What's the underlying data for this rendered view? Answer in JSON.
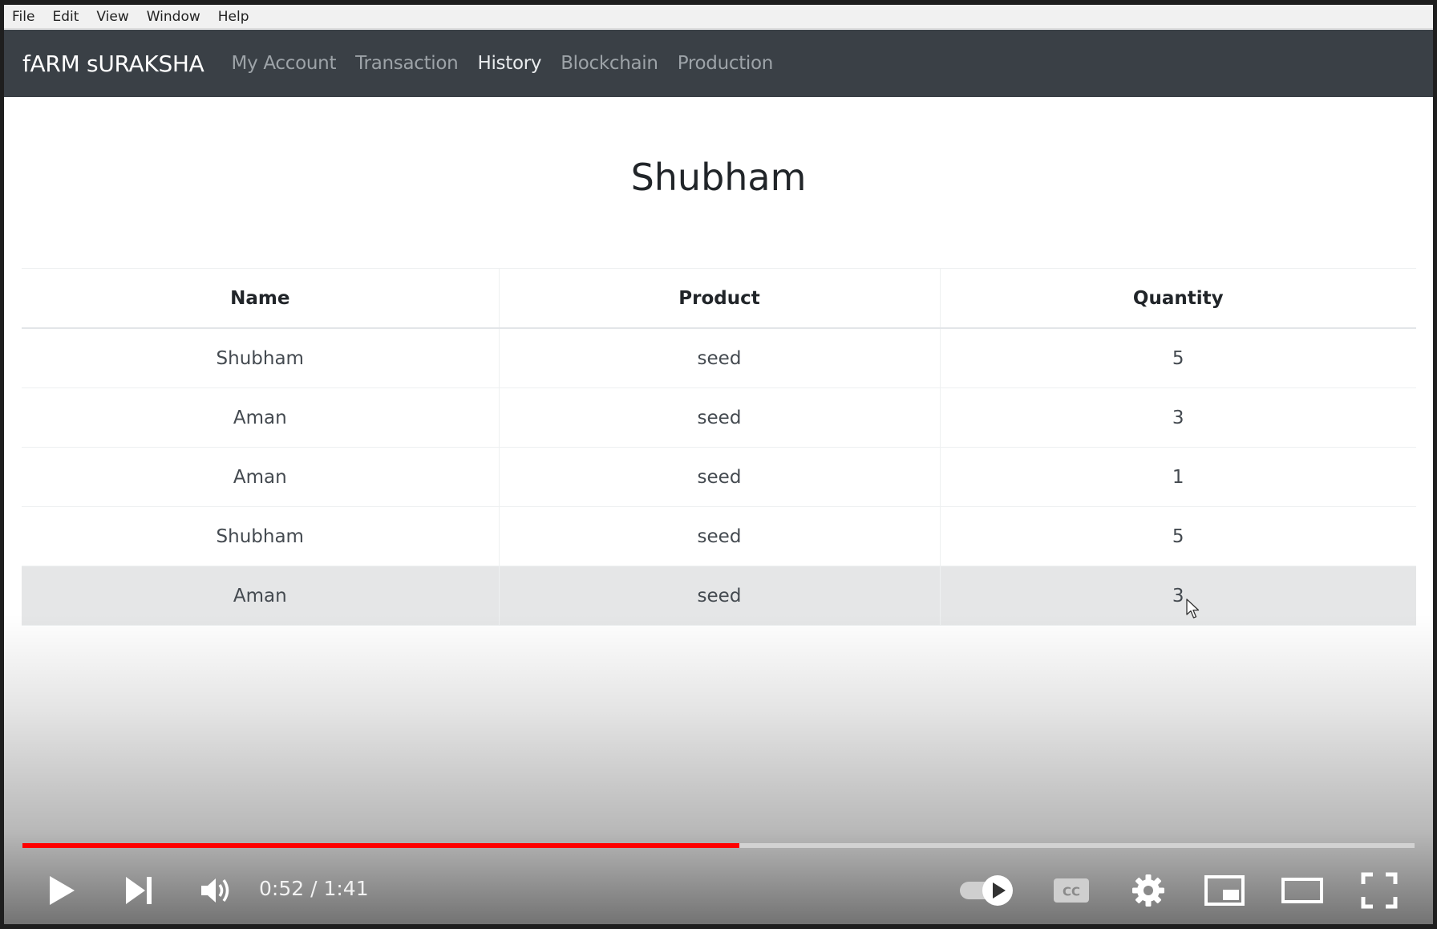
{
  "menubar": {
    "items": [
      "File",
      "Edit",
      "View",
      "Window",
      "Help"
    ]
  },
  "navbar": {
    "brand": "fARM sURAKSHA",
    "links": [
      {
        "label": "My Account",
        "active": false
      },
      {
        "label": "Transaction",
        "active": false
      },
      {
        "label": "History",
        "active": true
      },
      {
        "label": "Blockchain",
        "active": false
      },
      {
        "label": "Production",
        "active": false
      }
    ]
  },
  "page": {
    "title": "Shubham"
  },
  "table": {
    "headers": [
      "Name",
      "Product",
      "Quantity"
    ],
    "rows": [
      [
        "Shubham",
        "seed",
        "5"
      ],
      [
        "Aman",
        "seed",
        "3"
      ],
      [
        "Aman",
        "seed",
        "1"
      ],
      [
        "Shubham",
        "seed",
        "5"
      ],
      [
        "Aman",
        "seed",
        "3"
      ]
    ]
  },
  "player": {
    "current_time": "0:52",
    "duration": "1:41",
    "time_display": "0:52 / 1:41",
    "progress_fraction": 0.515,
    "progress_color": "#ff0000",
    "icons": [
      "play-icon",
      "next-icon",
      "volume-icon",
      "autoplay-toggle-icon",
      "captions-icon",
      "settings-icon",
      "miniplayer-icon",
      "theater-mode-icon",
      "fullscreen-icon"
    ]
  },
  "colors": {
    "navbar_bg": "#3a4046",
    "brand_text": "#ffffff",
    "nav_link": "#9da3a8",
    "nav_link_active": "#e9ecee"
  }
}
